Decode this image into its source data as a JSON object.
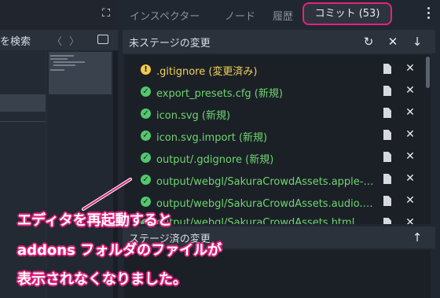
{
  "left": {
    "search_text": "を検索",
    "nav_prev": "〈",
    "nav_next": "〉",
    "expand_glyph": "⛶"
  },
  "tabs": {
    "inspector": "インスペクター",
    "node": "ノード",
    "history": "履歴",
    "commit": "コミット (53)"
  },
  "unstaged": {
    "title": "未ステージの変更",
    "refresh_glyph": "↻",
    "discard_glyph": "✕",
    "stage_all_glyph": "↓"
  },
  "files": [
    {
      "name": ".gitignore (変更済み)",
      "status": "modified",
      "status_glyph": "!"
    },
    {
      "name": "export_presets.cfg (新規)",
      "status": "new",
      "status_glyph": "✓"
    },
    {
      "name": "icon.svg (新規)",
      "status": "new",
      "status_glyph": "✓"
    },
    {
      "name": "icon.svg.import (新規)",
      "status": "new",
      "status_glyph": "✓"
    },
    {
      "name": "output/.gdignore (新規)",
      "status": "new",
      "status_glyph": "✓"
    },
    {
      "name": "output/webgl/SakuraCrowdAssets.apple-touch-icon.png (新規)",
      "status": "new",
      "status_glyph": "✓"
    },
    {
      "name": "output/webgl/SakuraCrowdAssets.audio.worklet.js (新規)",
      "status": "new",
      "status_glyph": "✓"
    },
    {
      "name": "output/webgl/SakuraCrowdAssets.html",
      "status": "new",
      "status_glyph": "✓"
    }
  ],
  "row_close_glyph": "✕",
  "staged": {
    "title": "ステージ済の変更",
    "unstage_glyph": "↑"
  },
  "annotation": {
    "line1": "エディタを再起動すると",
    "line2": "addons フォルダのファイルが",
    "line3": "表示されなくなりました。",
    "color": "#e0247f"
  },
  "colors": {
    "new_file": "#6fd56f",
    "modified_file": "#f2d15a",
    "highlight_border": "#e0247f"
  }
}
